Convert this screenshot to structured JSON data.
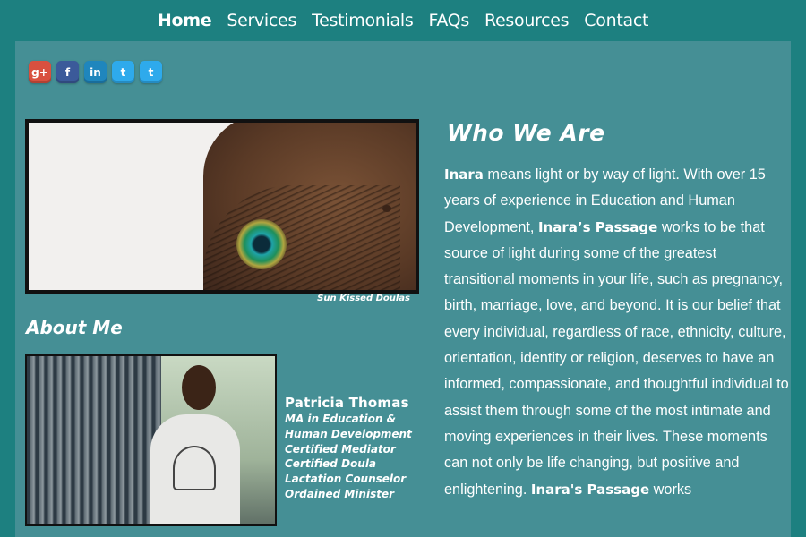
{
  "nav": {
    "items": [
      {
        "label": "Home",
        "active": true
      },
      {
        "label": "Services",
        "active": false
      },
      {
        "label": "Testimonials",
        "active": false
      },
      {
        "label": "FAQs",
        "active": false
      },
      {
        "label": "Resources",
        "active": false
      },
      {
        "label": "Contact",
        "active": false
      }
    ]
  },
  "social": [
    {
      "name": "google-plus",
      "glyph": "g+",
      "color": "#d9503f"
    },
    {
      "name": "facebook",
      "glyph": "f",
      "color": "#3b5a9a"
    },
    {
      "name": "linkedin",
      "glyph": "in",
      "color": "#1f86bd"
    },
    {
      "name": "twitter",
      "glyph": "t",
      "color": "#2eaaec"
    },
    {
      "name": "twitter",
      "glyph": "t",
      "color": "#2eaaec"
    }
  ],
  "hero": {
    "caption": "Sun Kissed Doulas"
  },
  "about": {
    "title": "About Me",
    "name": "Patricia Thomas",
    "credentials": [
      "MA in Education &",
      "Human Development",
      "Certified Mediator",
      "Certified Doula",
      "Lactation Counselor",
      "Ordained Minister"
    ]
  },
  "who": {
    "title": "Who We Are",
    "brand_short": "Inara",
    "brand": "Inara’s Passage",
    "brand2": "Inara's Passage",
    "text1": " means light or by way of light. With over 15 years of experience in Education and Human Development, ",
    "text2": " works to be that source of light during some of the greatest transitional moments in your life, such as pregnancy, birth, marriage, love, and beyond. It is our belief that every individual, regardless of race, ethnicity, culture, orientation, identity or religion, deserves to have an informed, compassionate, and thoughtful individual to assist them through some of the most intimate and moving experiences in their lives. These moments can not only be life changing, but positive and enlightening. ",
    "text3": " works"
  },
  "colors": {
    "background": "#1d8080",
    "panel": "#458f95"
  }
}
